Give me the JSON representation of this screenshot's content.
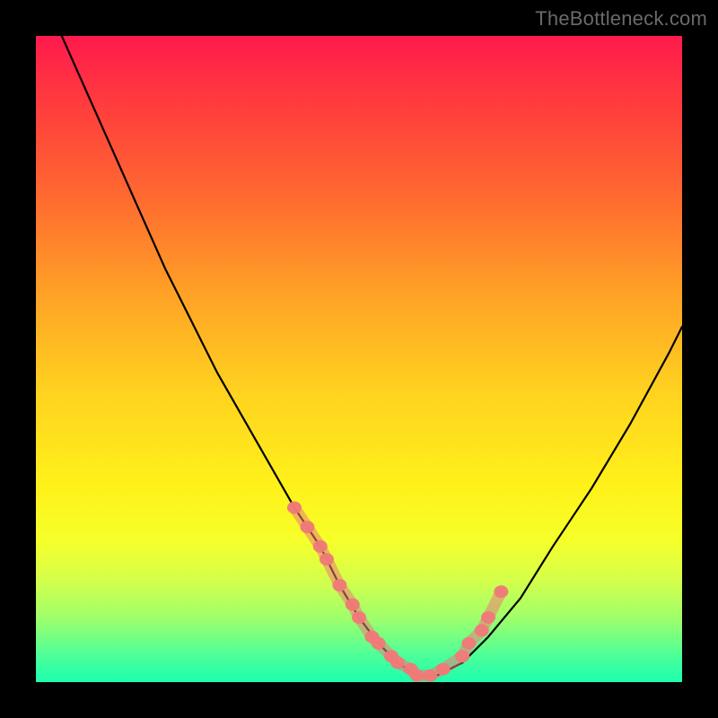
{
  "watermark": "TheBottleneck.com",
  "chart_data": {
    "type": "line",
    "title": "",
    "xlabel": "",
    "ylabel": "",
    "xlim": [
      0,
      100
    ],
    "ylim": [
      0,
      100
    ],
    "series": [
      {
        "name": "bottleneck-curve",
        "x": [
          4,
          8,
          12,
          16,
          20,
          24,
          28,
          32,
          36,
          40,
          44,
          47,
          50,
          53,
          56,
          59,
          62,
          66,
          70,
          75,
          80,
          86,
          92,
          98,
          100
        ],
        "y": [
          100,
          91,
          82,
          73,
          64,
          56,
          48,
          41,
          34,
          27,
          21,
          15,
          10,
          6,
          3,
          1,
          1,
          3,
          7,
          13,
          21,
          30,
          40,
          51,
          55
        ]
      }
    ],
    "markers": {
      "name": "curve-points",
      "x": [
        40,
        42,
        44,
        45,
        47,
        49,
        50,
        52,
        53,
        55,
        56,
        58,
        59,
        61,
        63,
        66,
        67,
        69,
        70,
        72
      ],
      "y": [
        27,
        24,
        21,
        19,
        15,
        12,
        10,
        7,
        6,
        4,
        3,
        2,
        1,
        1,
        2,
        4,
        6,
        8,
        10,
        14
      ]
    },
    "gradient_colors": {
      "top": "#ff1a4d",
      "mid": "#ffd21f",
      "bottom": "#1cffae"
    }
  }
}
